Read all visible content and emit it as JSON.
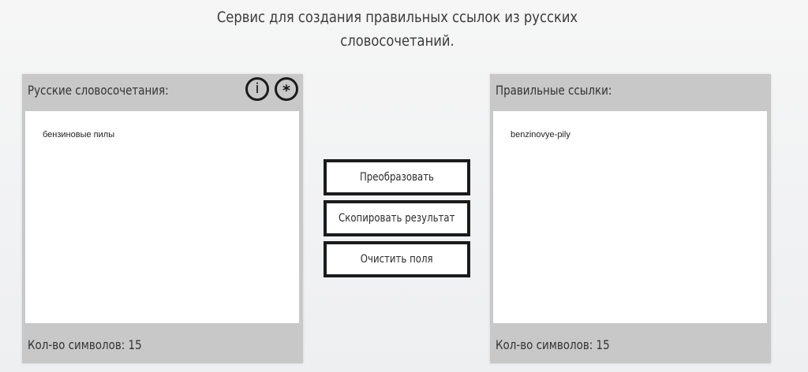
{
  "header": {
    "line1": "Сервис для создания правильных ссылок из русских",
    "line2": "словосочетаний."
  },
  "input_panel": {
    "title": "Русские словосочетания:",
    "value": "бензиновые пилы",
    "counter": "Кол-во символов: 15",
    "icons": {
      "info": "i",
      "star": "*"
    }
  },
  "output_panel": {
    "title": "Правильные ссылки:",
    "value": "benzinovye-pily",
    "counter": "Кол-во символов: 15"
  },
  "actions": {
    "convert": "Преобразовать",
    "copy": "Скопировать результат",
    "clear": "Очистить поля"
  }
}
